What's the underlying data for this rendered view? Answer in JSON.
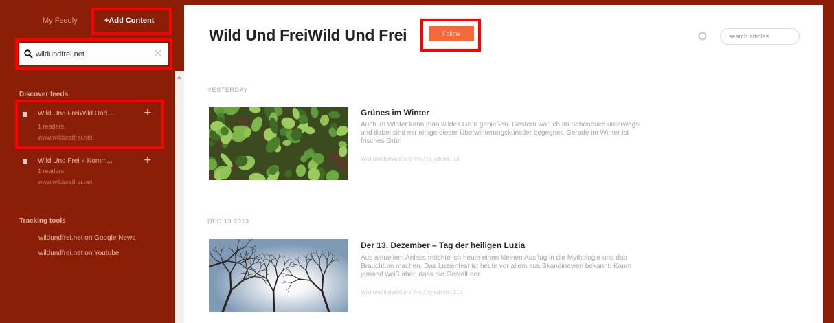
{
  "sidebar": {
    "tabs": [
      {
        "label": "My Feedly"
      },
      {
        "label": "+Add Content"
      }
    ],
    "search": {
      "value": "wildundfrei.net",
      "placeholder": ""
    },
    "discover_title": "Discover feeds",
    "feeds": [
      {
        "title": "Wild Und FreiWild Und ...",
        "readers": "1 readers",
        "url": "www.wildundfrei.net"
      },
      {
        "title": "Wild Und Frei » Komm...",
        "readers": "1 readers",
        "url": "www.wildundfrei.net"
      }
    ],
    "tracking_title": "Tracking tools",
    "tracking": [
      {
        "label": "wildundfrei.net on Google News"
      },
      {
        "label": "wildundfrei.net on Youtube"
      }
    ]
  },
  "main": {
    "title": "Wild Und FreiWild Und Frei",
    "follow_label": "Follow",
    "search_placeholder": "search articles",
    "sections": [
      {
        "date": "YESTERDAY",
        "article": {
          "title": "Grünes im Winter",
          "excerpt": "Auch im Winter kann man wildes Grün genießen. Gestern war ich im Schönbuch unterwegs und dabei sind mir einige dieser Überwinterungskünstler begegnet. Gerade im Winter ist frisches Grün",
          "meta": "Wild und freiWild und frei / by admin / 1d"
        }
      },
      {
        "date": "DEC 13 2013",
        "article": {
          "title": "Der 13. Dezember – Tag der heiligen Luzia",
          "excerpt": "Aus aktuellem Anlass möchte ich heute einen kleinen Ausflug in die Mythologie und das Brauchtum machen. Das Luzienfest ist heute vor allem aus Skandinavien bekannt. Kaum jemand weiß aber, dass die Gestalt der",
          "meta": "Wild und freiWild und frei / by admin / 21d"
        }
      }
    ]
  },
  "colors": {
    "sidebar_bg": "#8b1e06",
    "follow_button": "#f4693c",
    "annotation_box": "#ff0000"
  }
}
